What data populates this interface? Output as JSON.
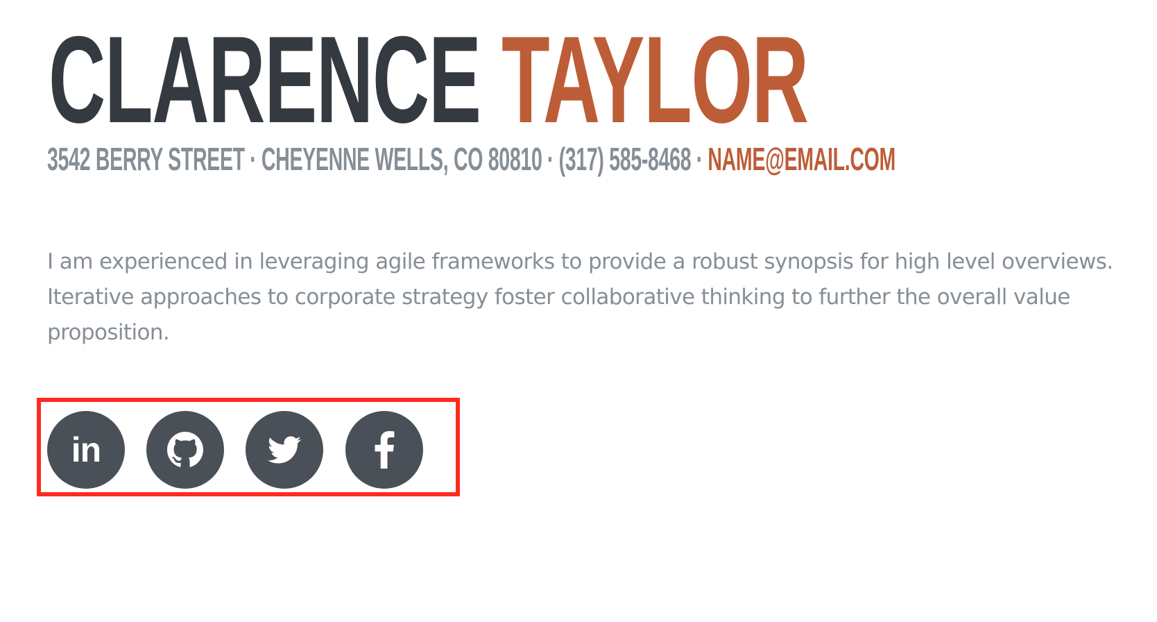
{
  "profile": {
    "first_name": "CLARENCE",
    "last_name": "TAYLOR",
    "contact": {
      "street": "3542 BERRY STREET",
      "separator": "·",
      "city": "CHEYENNE WELLS, CO 80810",
      "phone": "(317) 585-8468",
      "email": "NAME@EMAIL.COM"
    },
    "bio": "I am experienced in leveraging agile frameworks to provide a robust synopsis for high level overviews. Iterative approaches to corporate strategy foster collaborative thinking to further the overall value proposition."
  },
  "social": {
    "linkedin": {
      "icon": "linkedin-icon",
      "glyph": "in"
    },
    "github": {
      "icon": "github-icon"
    },
    "twitter": {
      "icon": "twitter-icon"
    },
    "facebook": {
      "icon": "facebook-icon"
    }
  },
  "colors": {
    "name_dark": "#343a40",
    "accent": "#bd5d38",
    "muted_text": "#868e96",
    "icon_bg": "#495057",
    "highlight_border": "#ff2a1f"
  }
}
